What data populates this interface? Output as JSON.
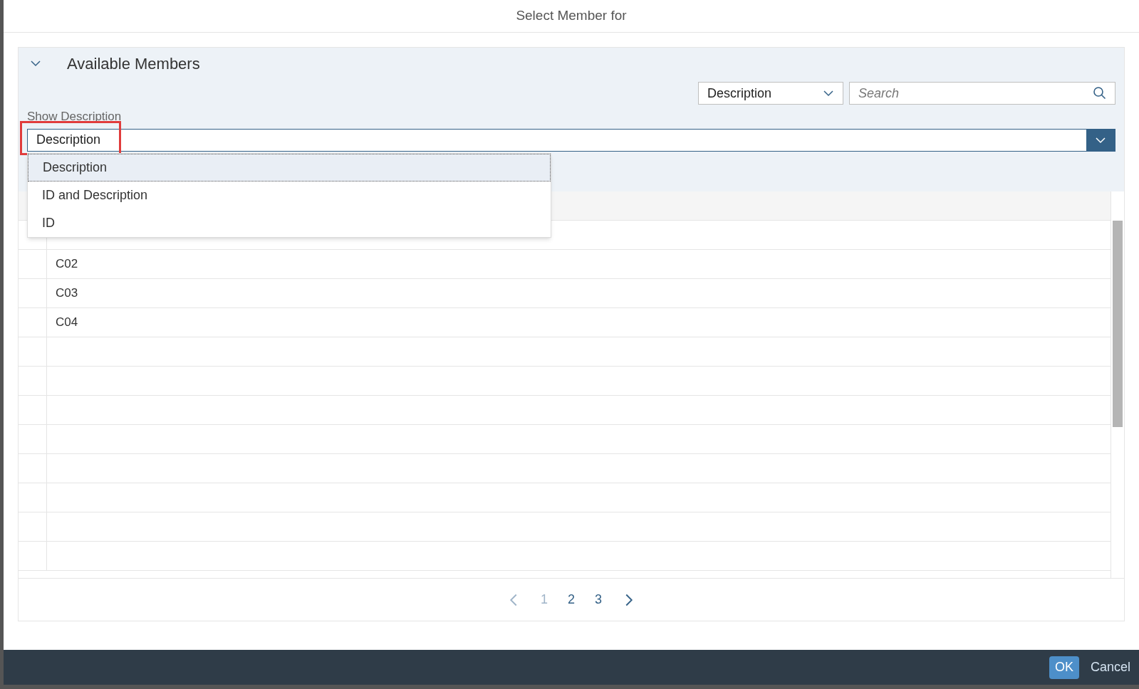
{
  "dialog": {
    "title": "Select Member for"
  },
  "panel": {
    "title": "Available Members",
    "expanded": true,
    "search_scope": {
      "value": "Description"
    },
    "search": {
      "placeholder": "Search"
    },
    "show_description": {
      "label": "Show Description",
      "value": "Description",
      "open": true,
      "options": [
        {
          "label": "Description",
          "selected": true
        },
        {
          "label": "ID and Description",
          "selected": false
        },
        {
          "label": "ID",
          "selected": false
        }
      ]
    }
  },
  "table": {
    "rows": [
      {},
      {
        "value": "C02"
      },
      {
        "value": "C03"
      },
      {
        "value": "C04"
      },
      {},
      {},
      {},
      {},
      {},
      {},
      {},
      {}
    ]
  },
  "pagination": {
    "prev_disabled": true,
    "pages": [
      {
        "label": "1",
        "selected": true
      },
      {
        "label": "2",
        "selected": false
      },
      {
        "label": "3",
        "selected": false
      }
    ]
  },
  "buttons": [
    {
      "label": "OK",
      "kind": "primary"
    },
    {
      "label": "Cancel",
      "kind": "plain"
    }
  ]
}
